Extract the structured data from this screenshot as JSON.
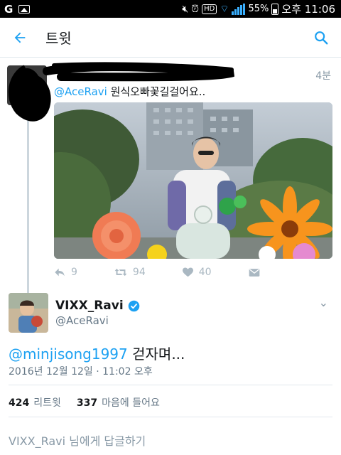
{
  "status_bar": {
    "battery_percent": "55%",
    "time": "오후 11:06",
    "icons": [
      "g-logo-icon",
      "gallery-icon",
      "mute-icon",
      "alarm-icon",
      "hd-icon",
      "wifi-icon",
      "signal-icon",
      "battery-icon"
    ]
  },
  "app_bar": {
    "title": "트윗",
    "back_icon": "arrow-left-icon",
    "search_icon": "search-icon"
  },
  "parent_tweet": {
    "time": "4분",
    "mention": "@AceRavi",
    "text": " 원식오빠꽃길걸어요..",
    "actions": {
      "reply_count": "9",
      "retweet_count": "94",
      "like_count": "40"
    }
  },
  "main_tweet": {
    "display_name": "VIXX_Ravi",
    "handle": "@AceRavi",
    "mention": "@minjisong1997",
    "text": " 걷자며...",
    "timestamp": "2016년 12월 12일 · 11:02 오후",
    "retweets": "424",
    "retweets_label": "리트윗",
    "likes": "337",
    "likes_label": "마음에 들어요"
  },
  "reply_bar": {
    "placeholder": "VIXX_Ravi 님에게 답글하기"
  },
  "colors": {
    "accent": "#1da1f2",
    "muted": "#8899a6"
  }
}
